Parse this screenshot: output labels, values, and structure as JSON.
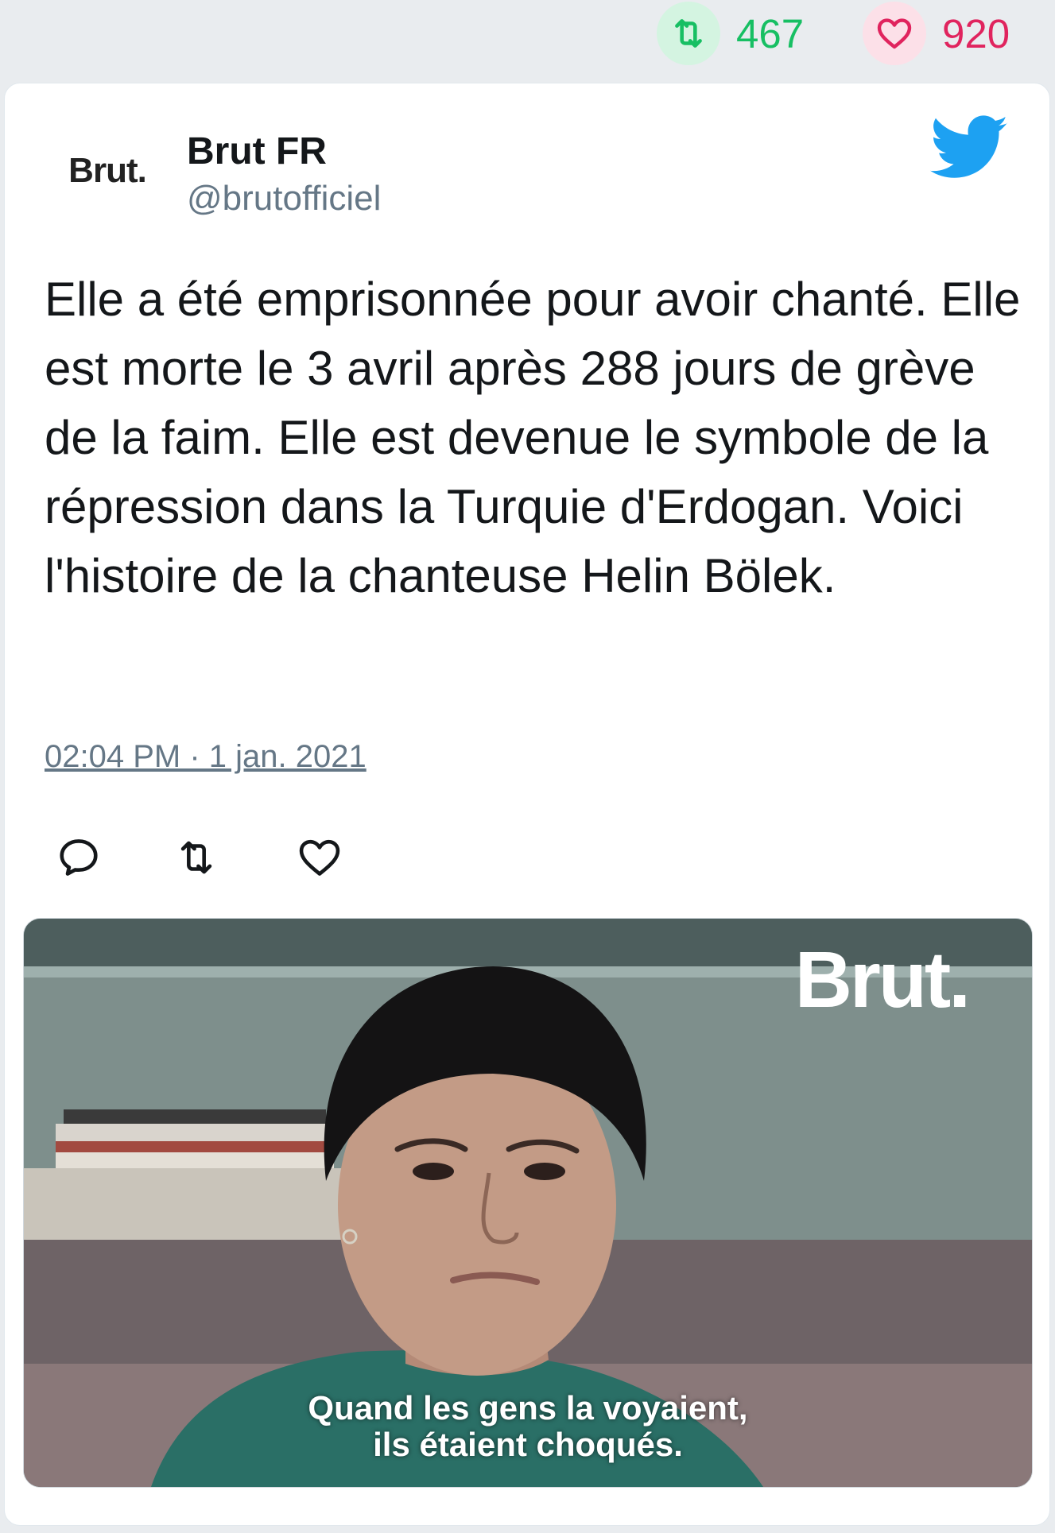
{
  "stats": {
    "retweet_icon": "retweet-icon",
    "retweets": "467",
    "like_icon": "heart-icon",
    "likes": "920"
  },
  "author": {
    "avatar_text": "Brut.",
    "name": "Brut FR",
    "handle": "@brutofficiel"
  },
  "tweet": {
    "text": "Elle a été emprisonnée pour avoir chanté. Elle est morte le 3 avril après 288 jours de grève de la faim. Elle est devenue le symbole de la répression dans la Turquie d'Erdogan. Voici l'histoire de la chanteuse Helin Bölek.",
    "timestamp": "02:04 PM · 1 jan. 2021"
  },
  "actions": [
    "reply-icon",
    "retweet-icon",
    "like-icon"
  ],
  "media": {
    "watermark": "Brut.",
    "caption_line1": "Quand les gens la voyaient,",
    "caption_line2": "ils étaient choqués."
  },
  "colors": {
    "retweet_green": "#17bf63",
    "like_red": "#e0245e",
    "twitter_blue": "#1da1f2",
    "muted_text": "#657786"
  }
}
